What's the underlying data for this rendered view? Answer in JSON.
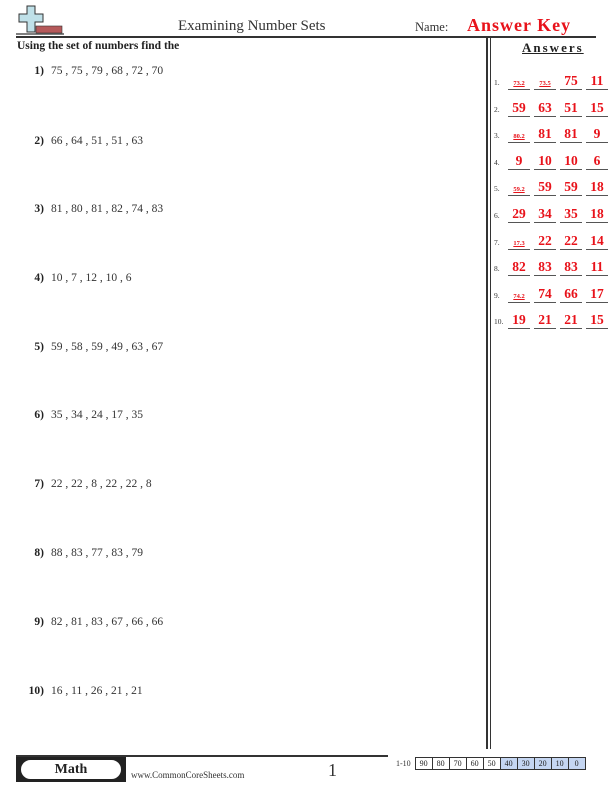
{
  "header": {
    "title": "Examining Number Sets",
    "name_label": "Name:",
    "name_value": "Answer Key",
    "instructions": "Using the set of numbers find the",
    "logo_icon": "plus-with-eraser-icon"
  },
  "answers": {
    "title": "Answers",
    "rows": [
      {
        "num": "1.",
        "values": [
          "73.2",
          "73.5",
          "75",
          "11"
        ]
      },
      {
        "num": "2.",
        "values": [
          "59",
          "63",
          "51",
          "15"
        ]
      },
      {
        "num": "3.",
        "values": [
          "80.2",
          "81",
          "81",
          "9"
        ]
      },
      {
        "num": "4.",
        "values": [
          "9",
          "10",
          "10",
          "6"
        ]
      },
      {
        "num": "5.",
        "values": [
          "59.2",
          "59",
          "59",
          "18"
        ]
      },
      {
        "num": "6.",
        "values": [
          "29",
          "34",
          "35",
          "18"
        ]
      },
      {
        "num": "7.",
        "values": [
          "17.3",
          "22",
          "22",
          "14"
        ]
      },
      {
        "num": "8.",
        "values": [
          "82",
          "83",
          "83",
          "11"
        ]
      },
      {
        "num": "9.",
        "values": [
          "74.2",
          "74",
          "66",
          "17"
        ]
      },
      {
        "num": "10.",
        "values": [
          "19",
          "21",
          "21",
          "15"
        ]
      }
    ]
  },
  "questions": [
    {
      "num": "1)",
      "values": "75 , 75 , 79 , 68 , 72 , 70"
    },
    {
      "num": "2)",
      "values": "66 , 64 , 51 , 51 , 63"
    },
    {
      "num": "3)",
      "values": "81 , 80 , 81 , 82 , 74 , 83"
    },
    {
      "num": "4)",
      "values": "10 , 7 , 12 , 10 , 6"
    },
    {
      "num": "5)",
      "values": "59 , 58 , 59 , 49 , 63 , 67"
    },
    {
      "num": "6)",
      "values": "35 , 34 , 24 , 17 , 35"
    },
    {
      "num": "7)",
      "values": "22 , 22 , 8 , 22 , 22 , 8"
    },
    {
      "num": "8)",
      "values": "88 , 83 , 77 , 83 , 79"
    },
    {
      "num": "9)",
      "values": "82 , 81 , 83 , 67 , 66 , 66"
    },
    {
      "num": "10)",
      "values": "16 , 11 , 26 , 21 , 21"
    }
  ],
  "footer": {
    "subject": "Math",
    "site": "www.CommonCoreSheets.com",
    "page": "1",
    "score_label": "1-10",
    "scores": [
      "90",
      "80",
      "70",
      "60",
      "50",
      "40",
      "30",
      "20",
      "10",
      "0"
    ],
    "highlight_color": "#c5d6f2"
  },
  "colors": {
    "answer_red": "#e8121a"
  }
}
